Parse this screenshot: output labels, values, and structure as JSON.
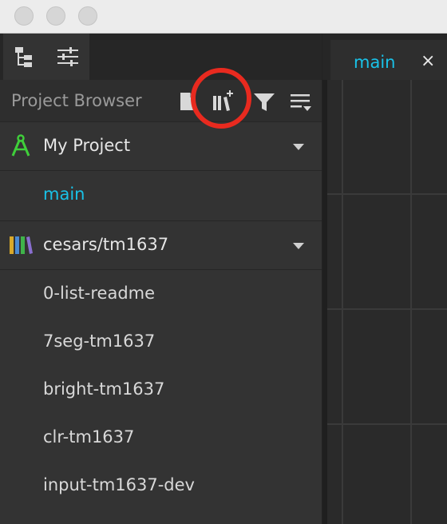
{
  "window": {
    "traffic_lights": [
      "close-button",
      "minimize-button",
      "zoom-button"
    ]
  },
  "toolbar": {
    "icons": [
      "hierarchy-icon",
      "sliders-icon"
    ]
  },
  "project_browser": {
    "title": "Project Browser",
    "header_icons": [
      "new-file-icon",
      "add-library-icon",
      "filter-icon",
      "menu-icon"
    ]
  },
  "tree": {
    "project": {
      "label": "My Project",
      "icon": "compass-icon"
    },
    "project_items": [
      {
        "label": "main",
        "active": true
      }
    ],
    "library": {
      "label": "cesars/tm1637",
      "icon": "library-icon"
    },
    "library_items": [
      {
        "label": "0-list-readme"
      },
      {
        "label": "7seg-tm1637"
      },
      {
        "label": "bright-tm1637"
      },
      {
        "label": "clr-tm1637"
      },
      {
        "label": "input-tm1637-dev"
      }
    ]
  },
  "editor": {
    "tab_label": "main",
    "close_glyph": "×"
  },
  "annotation": {
    "highlighted": "add-library-icon",
    "color": "#e82a1f"
  },
  "colors": {
    "accent": "#19c2e8",
    "project_icon": "#3fcf3a"
  }
}
